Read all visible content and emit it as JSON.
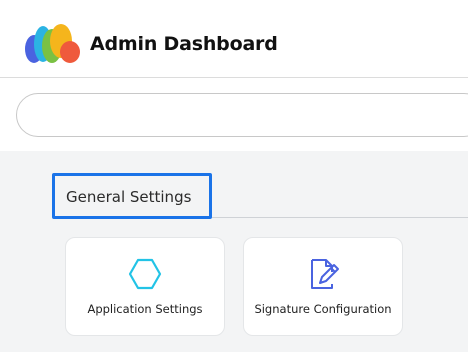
{
  "header": {
    "title": "Admin Dashboard",
    "logo_icon": "multicolor-cloud-logo"
  },
  "search": {
    "value": "",
    "placeholder": ""
  },
  "section": {
    "title": "General Settings"
  },
  "cards": [
    {
      "label": "Application Settings",
      "icon": "hexagon-icon",
      "icon_color": "#22c3e6"
    },
    {
      "label": "Signature Configuration",
      "icon": "edit-document-icon",
      "icon_color": "#4a63e0"
    }
  ],
  "colors": {
    "accent": "#1a73e8",
    "background": "#f3f4f5"
  }
}
